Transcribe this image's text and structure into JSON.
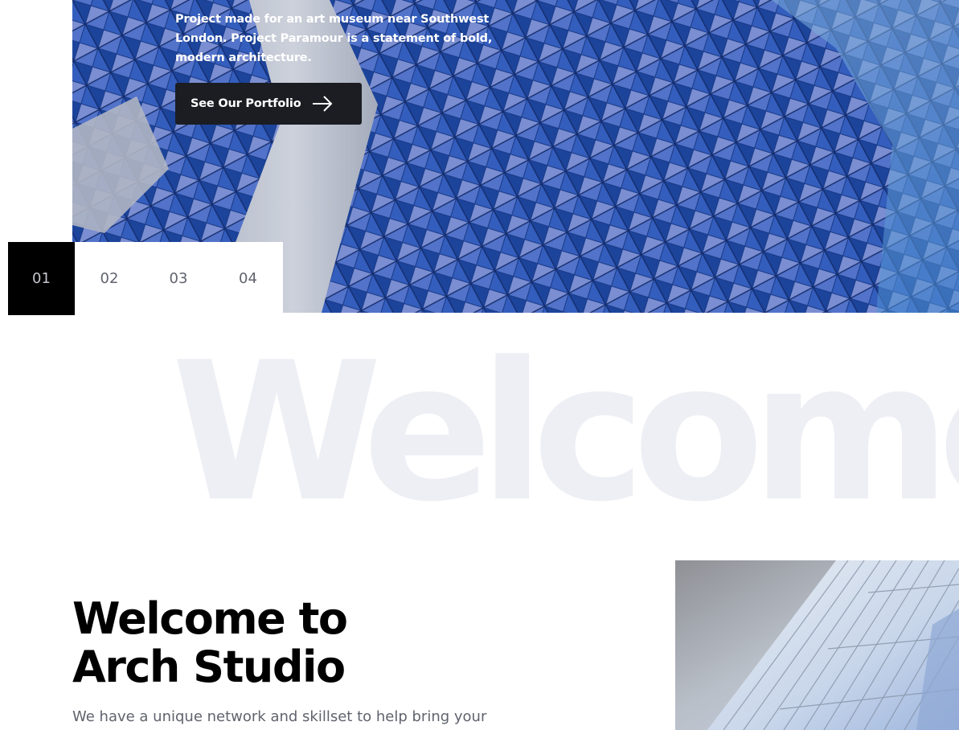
{
  "hero": {
    "description": "Project made for an art museum near Southwest London. Project Paramour is a statement of bold, modern architecture.",
    "button_label": "See Our Portfolio",
    "button_icon": "arrow-right-icon"
  },
  "pager": {
    "items": [
      "01",
      "02",
      "03",
      "04"
    ],
    "active_index": 0
  },
  "watermark": {
    "text": "Welcome"
  },
  "intro": {
    "title_line1": "Welcome to",
    "title_line2": "Arch Studio",
    "text": "We have a unique network and skillset to help bring your"
  },
  "colors": {
    "dark": "#1b1d23",
    "black": "#000000",
    "watermark": "#eeeff4",
    "text_gray": "#60636d",
    "hero_blue": "#2f5fc4"
  }
}
